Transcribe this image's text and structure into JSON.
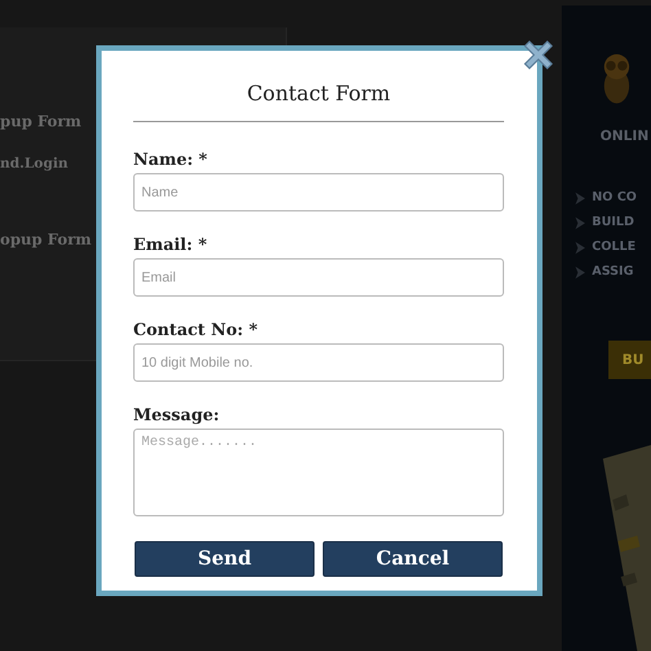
{
  "background_page": {
    "left_card": {
      "texts": [
        "pup Form",
        "nd.Login",
        "opup Form"
      ]
    },
    "right_panel": {
      "heading": "ONLIN",
      "items": [
        "NO CO",
        "BUILD",
        "COLLE",
        "ASSIG"
      ],
      "button": "BU"
    }
  },
  "modal": {
    "title": "Contact Form",
    "fields": [
      {
        "kind": "input",
        "label": "Name: *",
        "placeholder": "Name"
      },
      {
        "kind": "input",
        "label": "Email: *",
        "placeholder": "Email"
      },
      {
        "kind": "input",
        "label": "Contact No: *",
        "placeholder": "10 digit Mobile no."
      },
      {
        "kind": "textarea",
        "label": "Message:",
        "placeholder": "Message......."
      }
    ],
    "buttons": [
      "Send",
      "Cancel"
    ]
  }
}
